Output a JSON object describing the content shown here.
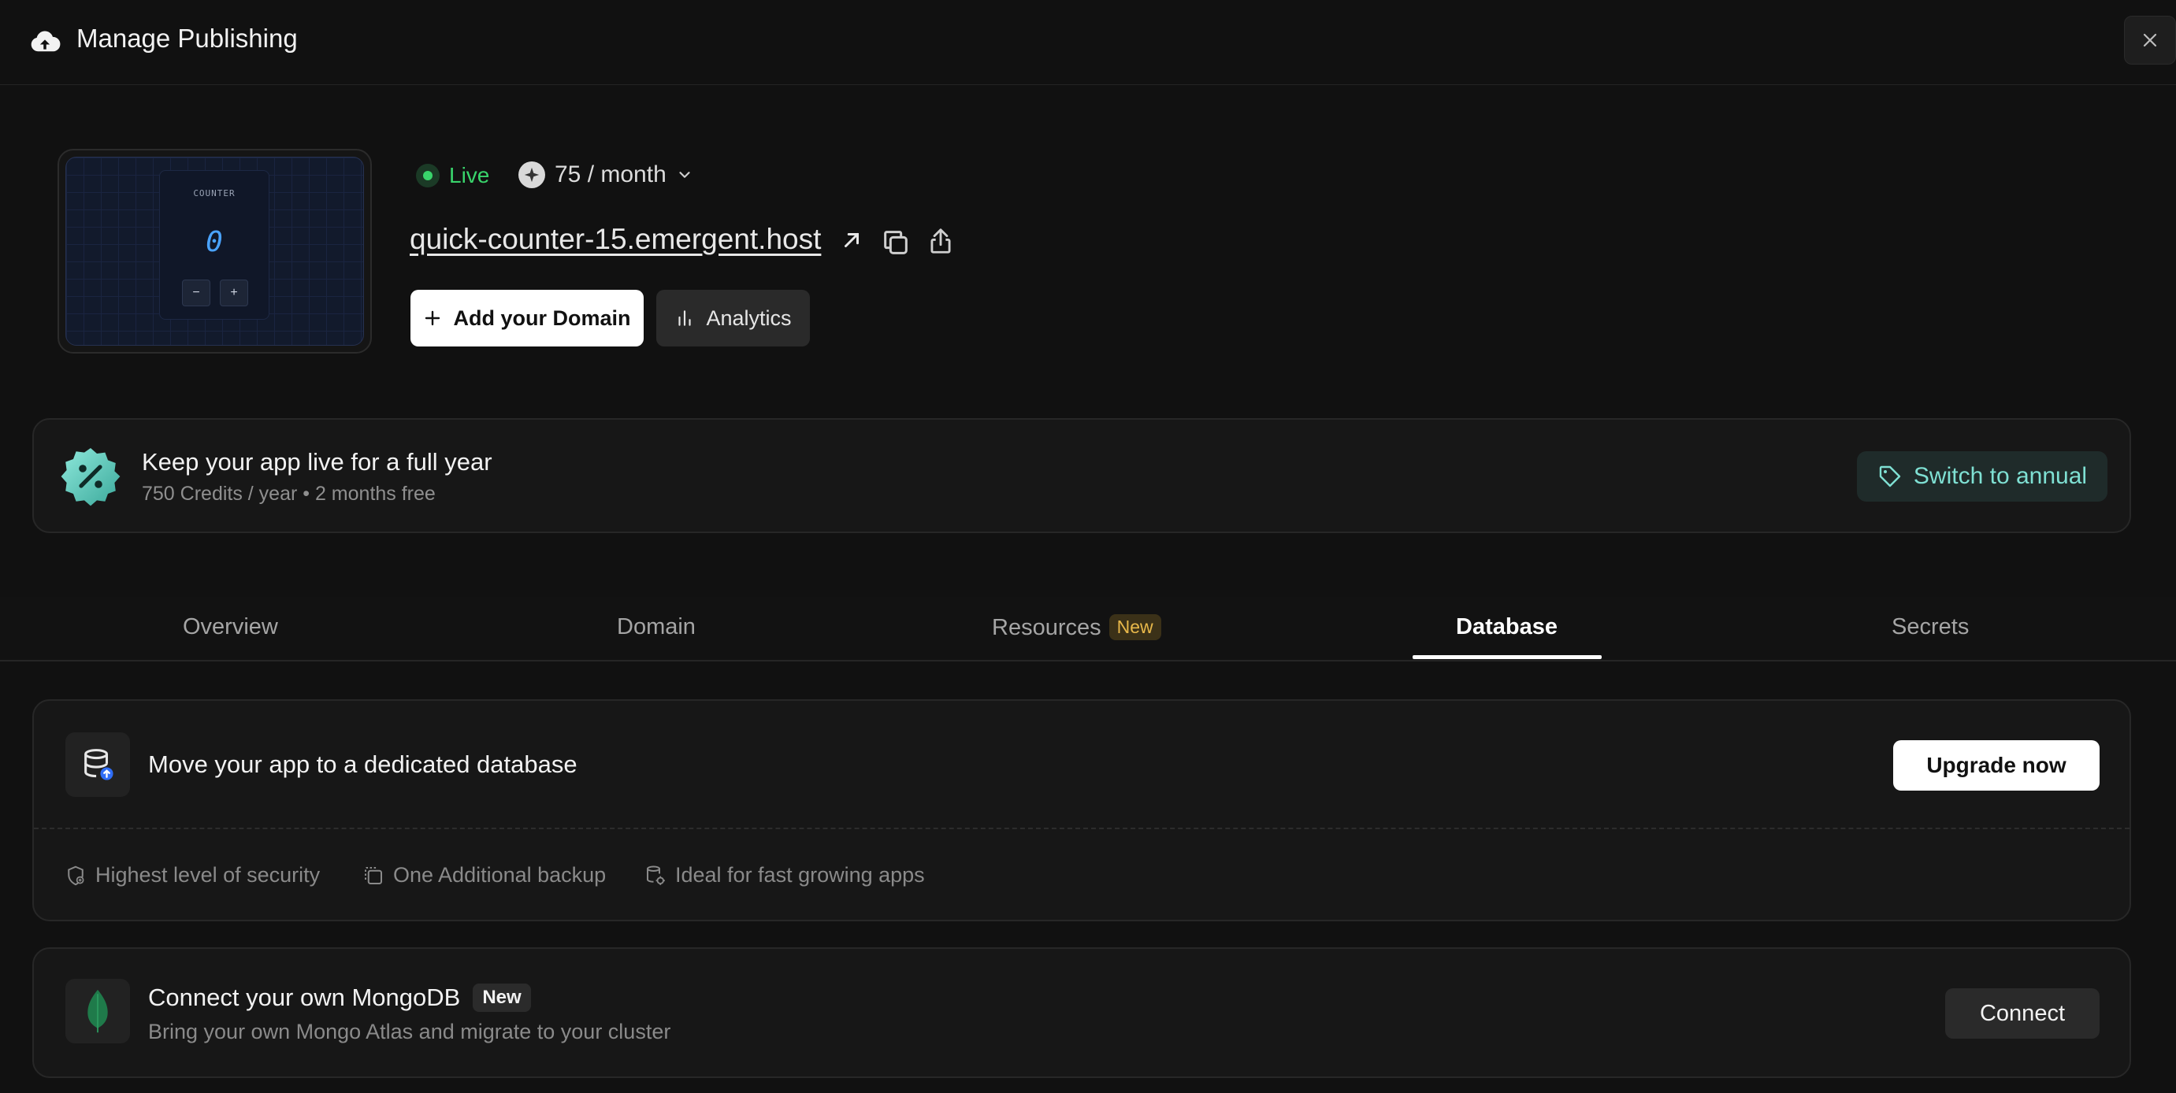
{
  "header": {
    "title": "Manage Publishing",
    "close_icon": "close-icon",
    "upload_icon": "cloud-upload-icon"
  },
  "preview": {
    "counter_label": "COUNTER",
    "counter_value": "0",
    "minus_label": "−",
    "plus_label": "+"
  },
  "status": {
    "live_label": "Live",
    "price_label": "75 / month",
    "live_color": "#39d46b"
  },
  "host": {
    "url": "quick-counter-15.emergent.host"
  },
  "actions": {
    "add_domain_label": "Add your Domain",
    "analytics_label": "Analytics"
  },
  "annual": {
    "title": "Keep your app live for a full year",
    "subtitle": "750 Credits / year • 2 months free",
    "switch_label": "Switch to annual",
    "accent_color": "#7fe0d3"
  },
  "tabs": {
    "items": [
      {
        "label": "Overview"
      },
      {
        "label": "Domain"
      },
      {
        "label": "Resources",
        "badge": "New"
      },
      {
        "label": "Database",
        "active": true
      },
      {
        "label": "Secrets"
      }
    ]
  },
  "database": {
    "title": "Move your app to a dedicated database",
    "upgrade_label": "Upgrade now",
    "features": [
      {
        "label": "Highest level of security",
        "icon": "shield-plus-icon"
      },
      {
        "label": "One Additional backup",
        "icon": "backup-copy-icon"
      },
      {
        "label": "Ideal for fast growing apps",
        "icon": "database-gear-icon"
      }
    ]
  },
  "mongo": {
    "title": "Connect your own MongoDB",
    "badge": "New",
    "subtitle": "Bring your own Mongo Atlas and migrate to your cluster",
    "connect_label": "Connect"
  }
}
